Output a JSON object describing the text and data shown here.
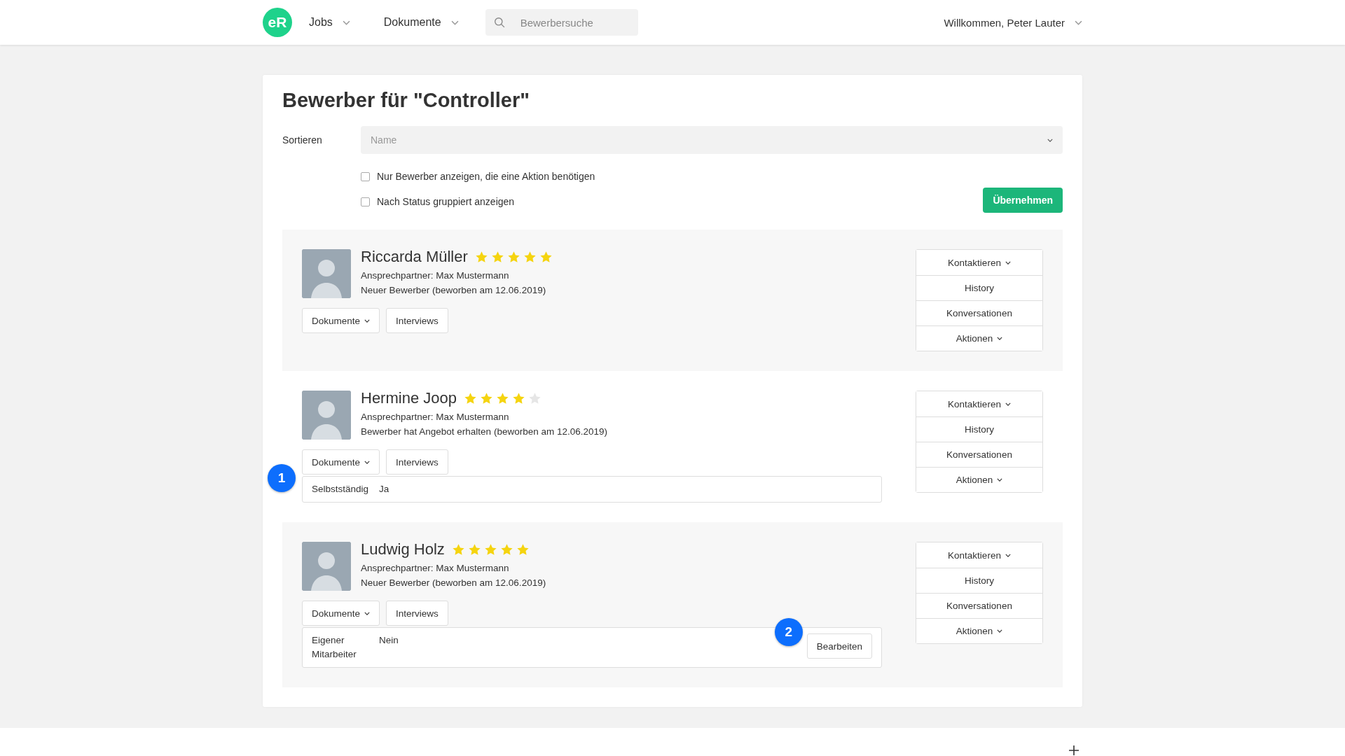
{
  "header": {
    "logo": "eR",
    "nav": [
      {
        "label": "Jobs"
      },
      {
        "label": "Dokumente"
      }
    ],
    "search": {
      "placeholder": "Bewerbersuche"
    },
    "user_menu": "Willkommen, Peter Lauter"
  },
  "page": {
    "title": "Bewerber für \"Controller\"",
    "sort": {
      "label": "Sortieren",
      "placeholder": "Name"
    },
    "filters": [
      {
        "label": "Nur Bewerber anzeigen, die eine Aktion benötigen",
        "checked": false
      },
      {
        "label": "Nach Status gruppiert anzeigen",
        "checked": false
      }
    ],
    "apply_button": "Übernehmen"
  },
  "candidates": [
    {
      "name": "Riccarda Müller",
      "stars": 5,
      "contact": "Ansprechpartner: Max Mustermann",
      "status": "Neuer Bewerber (beworben am 12.06.2019)",
      "buttons": [
        {
          "label": "Dokumente",
          "kind": "menu"
        },
        {
          "label": "Interviews",
          "kind": "plain"
        }
      ],
      "actions": [
        {
          "label": "Kontaktieren",
          "kind": "menu"
        },
        {
          "label": "History",
          "kind": "plain"
        },
        {
          "label": "Konversationen",
          "kind": "plain"
        },
        {
          "label": "Aktionen",
          "kind": "menu"
        }
      ]
    },
    {
      "name": "Hermine Joop",
      "stars": 4,
      "contact": "Ansprechpartner: Max Mustermann",
      "status": "Bewerber hat Angebot erhalten (beworben am 12.06.2019)",
      "buttons": [
        {
          "label": "Dokumente",
          "kind": "menu"
        },
        {
          "label": "Interviews",
          "kind": "plain"
        }
      ],
      "actions": [
        {
          "label": "Kontaktieren",
          "kind": "menu"
        },
        {
          "label": "History",
          "kind": "plain"
        },
        {
          "label": "Konversationen",
          "kind": "plain"
        },
        {
          "label": "Aktionen",
          "kind": "menu"
        }
      ],
      "fields": {
        "marker": "1",
        "rows": [
          {
            "label": "Selbstständig",
            "value": "Ja"
          }
        ]
      }
    },
    {
      "name": "Ludwig Holz",
      "stars": 5,
      "contact": "Ansprechpartner: Max Mustermann",
      "status": "Neuer Bewerber (beworben am 12.06.2019)",
      "buttons": [
        {
          "label": "Dokumente",
          "kind": "menu"
        },
        {
          "label": "Interviews",
          "kind": "plain"
        }
      ],
      "actions": [
        {
          "label": "Kontaktieren",
          "kind": "menu"
        },
        {
          "label": "History",
          "kind": "plain"
        },
        {
          "label": "Konversationen",
          "kind": "plain"
        },
        {
          "label": "Aktionen",
          "kind": "menu"
        }
      ],
      "fields": {
        "rows": [
          {
            "label": "Eigener Mitarbeiter",
            "value": "Nein"
          }
        ],
        "edit_button": {
          "label": "Bearbeiten",
          "marker": "2"
        }
      }
    }
  ]
}
